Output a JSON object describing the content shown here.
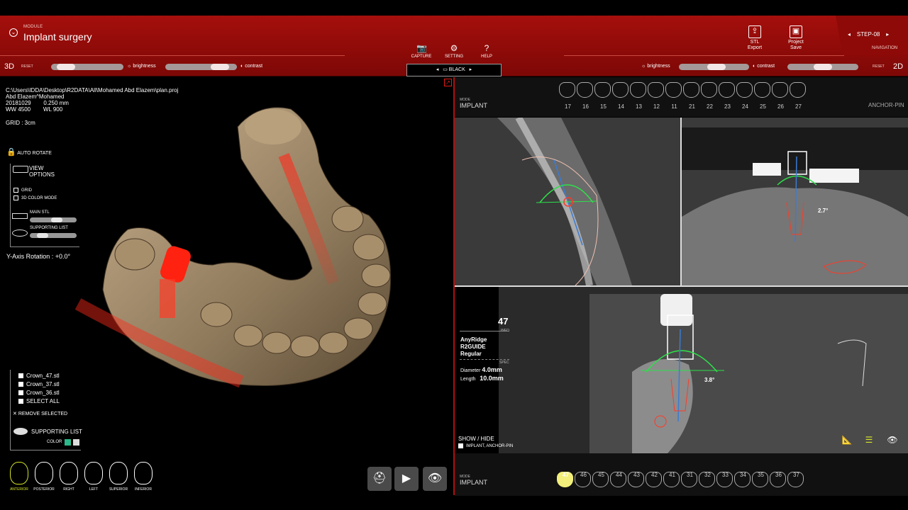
{
  "header": {
    "module_small": "MODULE",
    "module_title": "Implant surgery",
    "tools": [
      {
        "icon": "camera-icon",
        "label": "CAPTURE"
      },
      {
        "icon": "gear-icon",
        "label": "SETTING"
      },
      {
        "icon": "help-icon",
        "label": "HELP"
      }
    ],
    "display_mode": "BLACK",
    "stl_export": "STL\nExport",
    "project_save": "Project\nSave",
    "step": "STEP-08",
    "navigation": "NAVIGATION",
    "left_label": "3D",
    "right_label": "2D",
    "reset": "RESET",
    "brightness": "brightness",
    "contrast": "contrast"
  },
  "sliders": {
    "left_brightness": 0.1,
    "left_contrast": 0.85,
    "right_brightness": 0.55,
    "right_contrast": 0.5
  },
  "info": {
    "path": "C:\\Users\\IDDA\\Desktop\\R2DATA\\All\\Mohamed Abd Elazem\\plan.proj",
    "patient": "Abd Elazem^Mohamed",
    "date": "20181029",
    "voxel": "0.250 mm",
    "ww": "WW 4500",
    "wl": "WL 900",
    "grid": "GRID : 3cm"
  },
  "left_panel": {
    "auto_rotate": "AUTO ROTATE",
    "view_options": "VIEW\nOPTIONS",
    "grid": "GRID",
    "color_mode": "3D COLOR MODE",
    "main_stl": "MAIN STL",
    "supporting_list": "SUPPORTING LIST",
    "y_rotation": "Y-Axis Rotation : +0.0°",
    "main_stl_level": 0.6,
    "supporting_level": 0.2
  },
  "stl_list": {
    "items": [
      "Crown_47.stl",
      "Crown_37.stl",
      "Crown_36.stl"
    ],
    "select_all": "SELECT ALL",
    "remove": "REMOVE SELECTED",
    "supporting_title": "SUPPORTING LIST",
    "color": "COLOR"
  },
  "views": [
    "ANTERIOR",
    "POSTERIOR",
    "RIGHT",
    "LEFT",
    "SUPERIOR",
    "INFERIOR"
  ],
  "upper_bar": {
    "mode_small": "MODE",
    "mode": "IMPLANT",
    "right_mode": "ANCHOR-PIN",
    "teeth": [
      "17",
      "16",
      "15",
      "14",
      "13",
      "12",
      "11",
      "21",
      "22",
      "23",
      "24",
      "25",
      "26",
      "27"
    ]
  },
  "lower_bar": {
    "mode_small": "MODE",
    "mode": "IMPLANT",
    "teeth": [
      "47",
      "46",
      "45",
      "44",
      "43",
      "42",
      "41",
      "31",
      "32",
      "33",
      "34",
      "35",
      "36",
      "37"
    ]
  },
  "implant": {
    "number": "47",
    "info": "INFO",
    "brand": "AnyRidge",
    "guide": "R2GUIDE",
    "type": "Regular",
    "spec": "SPEC",
    "diameter_label": "Diameter",
    "diameter": "4.0mm",
    "length_label": "Length",
    "length": "10.0mm",
    "show_hide": "SHOW / HIDE",
    "show_item": "IMPLANT, ANCHOR-PIN"
  },
  "angles": {
    "sagittal": "2.7°",
    "axial": "3.8°"
  },
  "colors": {
    "header": "#a50f0c",
    "accent": "#e11a12",
    "tooth": "#b09a7e"
  }
}
